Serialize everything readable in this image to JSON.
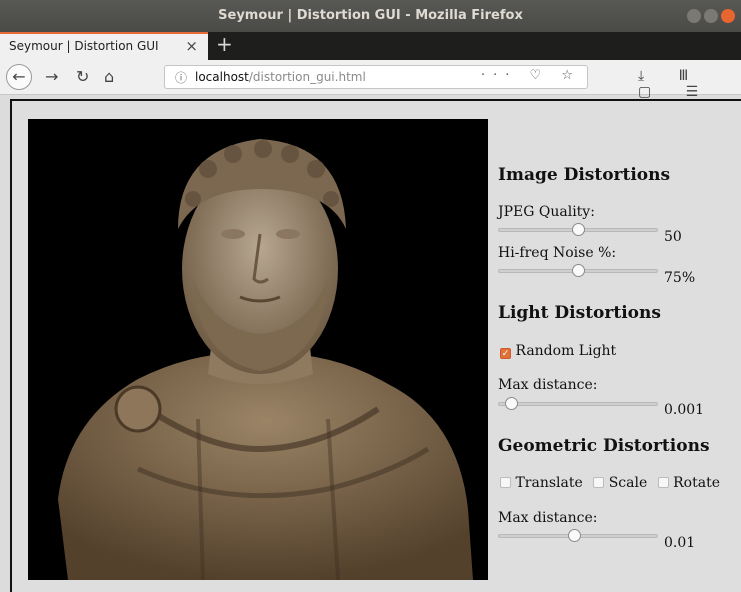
{
  "window": {
    "title": "Seymour | Distortion GUI - Mozilla Firefox"
  },
  "tab": {
    "label": "Seymour | Distortion GUI",
    "close": "×",
    "new_tab": "+"
  },
  "nav": {
    "back": "←",
    "forward": "→",
    "reload": "↻",
    "home": "⌂",
    "url_host": "localhost",
    "url_path": "/distortion_gui.html",
    "url_info": "ⓘ",
    "url_icons": "··· ♡ ☆",
    "tool_icons": "⤓ Ⅲ ▢ ☰"
  },
  "image": {
    "alt": "Marble bust of a bearded Roman emperor on black background"
  },
  "image_distortions": {
    "heading": "Image Distortions",
    "jpeg_label": "JPEG Quality:",
    "jpeg_value": "50",
    "jpeg_fraction": 0.5,
    "noise_label": "Hi-freq Noise %:",
    "noise_value": "75%",
    "noise_fraction": 0.5
  },
  "light_distortions": {
    "heading": "Light Distortions",
    "random_light_label": "Random Light",
    "random_light_checked": true,
    "max_distance_label": "Max distance:",
    "max_distance_value": "0.001",
    "max_distance_fraction": 0.05
  },
  "geometric_distortions": {
    "heading": "Geometric Distortions",
    "translate_label": "Translate",
    "scale_label": "Scale",
    "rotate_label": "Rotate",
    "max_distance_label": "Max distance:",
    "max_distance_value": "0.01",
    "max_distance_fraction": 0.47
  }
}
